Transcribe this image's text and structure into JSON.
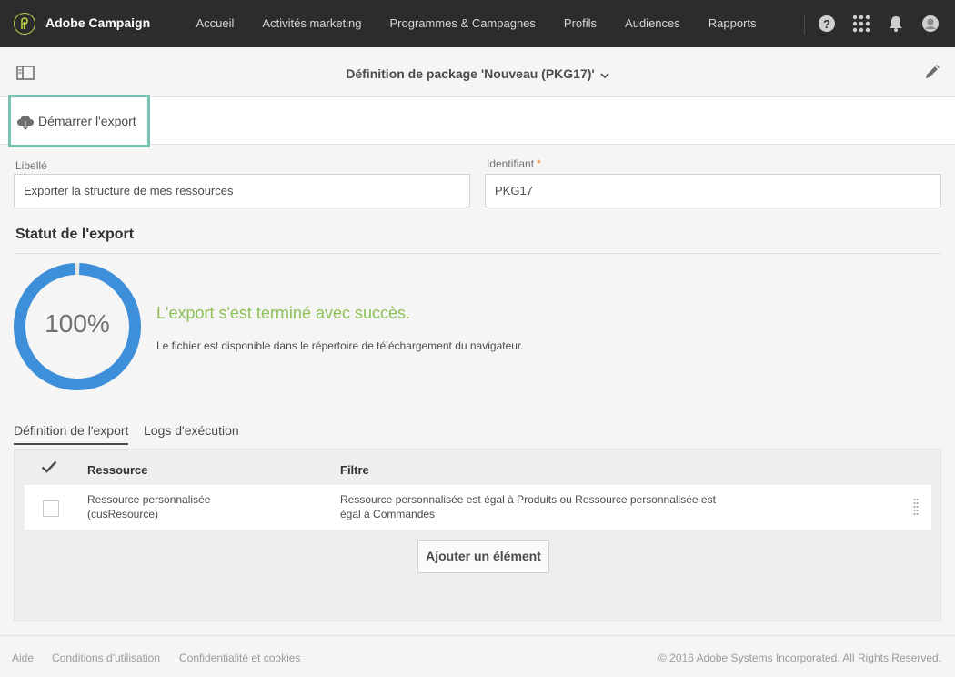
{
  "app": {
    "name": "Adobe Campaign"
  },
  "nav": {
    "items": [
      {
        "label": "Accueil"
      },
      {
        "label": "Activités marketing"
      },
      {
        "label": "Programmes & Campagnes"
      },
      {
        "label": "Profils"
      },
      {
        "label": "Audiences"
      },
      {
        "label": "Rapports"
      }
    ],
    "icons": [
      "help-icon",
      "apps-grid-icon",
      "bell-icon",
      "user-avatar-icon"
    ]
  },
  "header": {
    "title": "Définition de package 'Nouveau (PKG17)'"
  },
  "actions": {
    "start_export": "Démarrer l'export"
  },
  "form": {
    "label_field": {
      "label": "Libellé",
      "value": "Exporter la structure de mes ressources"
    },
    "id_field": {
      "label": "Identifiant",
      "required_mark": "*",
      "value": "PKG17"
    }
  },
  "status": {
    "title": "Statut de l'export",
    "progress": 100,
    "percent_label": "100%",
    "message": "L'export s'est terminé avec succès.",
    "info": "Le fichier est disponible dans le répertoire de téléchargement du navigateur."
  },
  "tabs": [
    {
      "label": "Définition de l'export",
      "active": true
    },
    {
      "label": "Logs d'exécution",
      "active": false
    }
  ],
  "table": {
    "columns": [
      "Ressource",
      "Filtre"
    ],
    "rows": [
      {
        "resource_line1": "Ressource personnalisée",
        "resource_line2": "(cusResource)",
        "filter_line1": "Ressource personnalisée est égal à Produits ou Ressource personnalisée est",
        "filter_line2": "égal à Commandes"
      }
    ],
    "add_button": "Ajouter un élément"
  },
  "footer": {
    "links": [
      "Aide",
      "Conditions d'utilisation",
      "Confidentialité et cookies"
    ],
    "copyright": "© 2016 Adobe Systems Incorporated. All Rights Reserved."
  },
  "colors": {
    "accent_green": "#8dc158",
    "progress_blue": "#3d8fd9",
    "highlight_teal": "#79c2b1",
    "required_orange": "#e68619"
  }
}
